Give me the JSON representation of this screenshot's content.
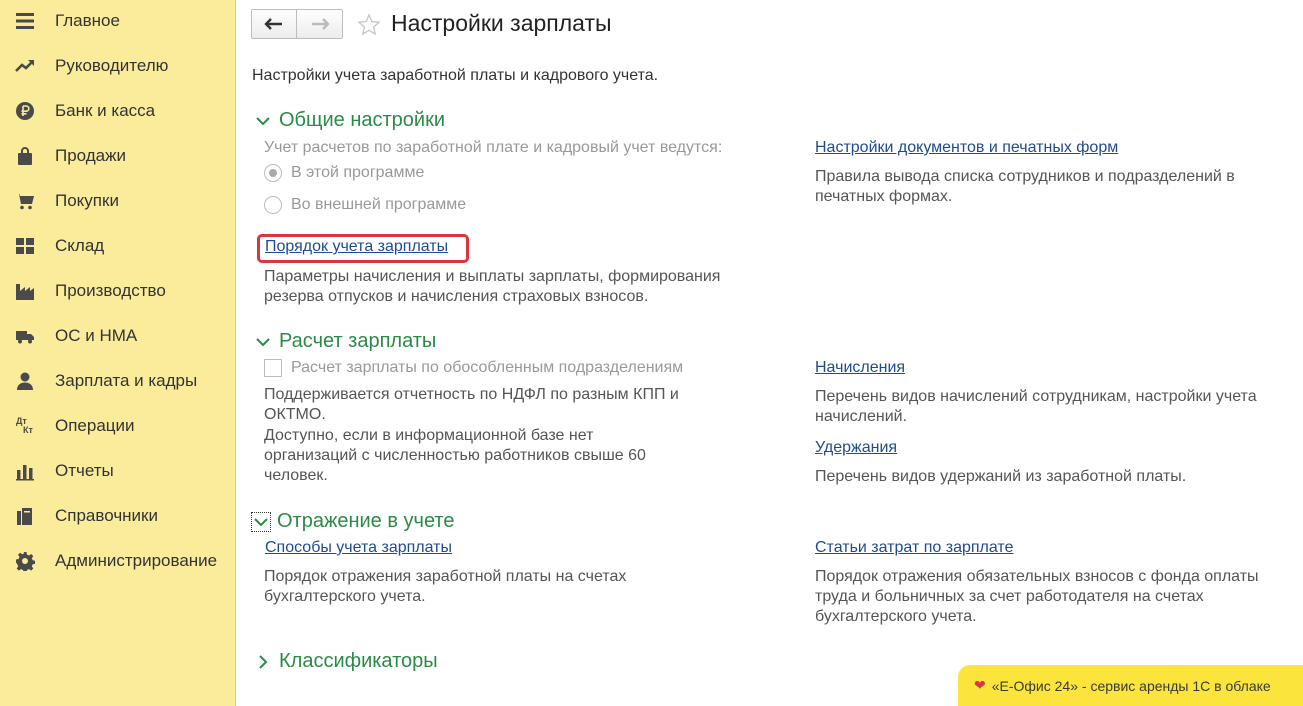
{
  "sidebar": {
    "items": [
      {
        "label": "Главное",
        "icon": "menu-icon"
      },
      {
        "label": "Руководителю",
        "icon": "trend-icon"
      },
      {
        "label": "Банк и касса",
        "icon": "ruble-icon"
      },
      {
        "label": "Продажи",
        "icon": "bag-icon"
      },
      {
        "label": "Покупки",
        "icon": "cart-icon"
      },
      {
        "label": "Склад",
        "icon": "grid-icon"
      },
      {
        "label": "Производство",
        "icon": "factory-icon"
      },
      {
        "label": "ОС и НМА",
        "icon": "truck-icon"
      },
      {
        "label": "Зарплата и кадры",
        "icon": "person-icon"
      },
      {
        "label": "Операции",
        "icon": "dt-kt-icon"
      },
      {
        "label": "Отчеты",
        "icon": "bar-chart-icon"
      },
      {
        "label": "Справочники",
        "icon": "books-icon"
      },
      {
        "label": "Администрирование",
        "icon": "gear-icon"
      }
    ],
    "dtkt_top": "Дт",
    "dtkt_bottom": "Кт"
  },
  "header": {
    "title": "Настройки зарплаты"
  },
  "subtitle": "Настройки учета заработной платы и кадрового учета.",
  "sections": {
    "general": {
      "title": "Общие настройки",
      "accounting_label": "Учет расчетов по заработной плате и кадровый учет ведутся:",
      "radio_this": "В этой программе",
      "radio_external": "Во внешней программе",
      "link_order": "Порядок учета зарплаты",
      "order_desc_1": "Параметры начисления и выплаты зарплаты, формирования",
      "order_desc_2": "резерва отпусков и начисления страховых взносов.",
      "link_docs": "Настройки документов и печатных форм",
      "docs_desc_1": "Правила вывода списка сотрудников и подразделений в",
      "docs_desc_2": "печатных формах."
    },
    "payroll": {
      "title": "Расчет зарплаты",
      "checkbox_label": "Расчет зарплаты по обособленным подразделениям",
      "desc_1": "Поддерживается отчетность по НДФЛ по разным КПП и",
      "desc_2": "ОКТМО.",
      "desc_3": "Доступно, если в информационной базе нет",
      "desc_4": "организаций с численностью работников свыше 60",
      "desc_5": "человек.",
      "link_accruals": "Начисления",
      "accruals_desc_1": "Перечень видов начислений сотрудникам, настройки учета",
      "accruals_desc_2": "начислений.",
      "link_deductions": "Удержания",
      "deductions_desc": "Перечень видов удержаний из заработной платы."
    },
    "reflection": {
      "title": "Отражение в учете",
      "link_methods": "Способы учета зарплаты",
      "methods_desc_1": "Порядок отражения заработной платы на счетах",
      "methods_desc_2": "бухгалтерского учета.",
      "link_costs": "Статьи затрат по зарплате",
      "costs_desc_1": "Порядок отражения обязательных взносов с фонда оплаты",
      "costs_desc_2": "труда и больничных за счет работодателя на счетах",
      "costs_desc_3": "бухгалтерского учета."
    },
    "classifiers": {
      "title": "Классификаторы"
    }
  },
  "promo": {
    "text": "«Е-Офис 24» - сервис аренды 1С в облаке"
  },
  "colors": {
    "sidebar_bg": "#fbec9c",
    "section_title": "#2b8a47",
    "link": "#1f4b8f",
    "highlight": "#d9363e",
    "promo_bg": "#fbe53c"
  }
}
